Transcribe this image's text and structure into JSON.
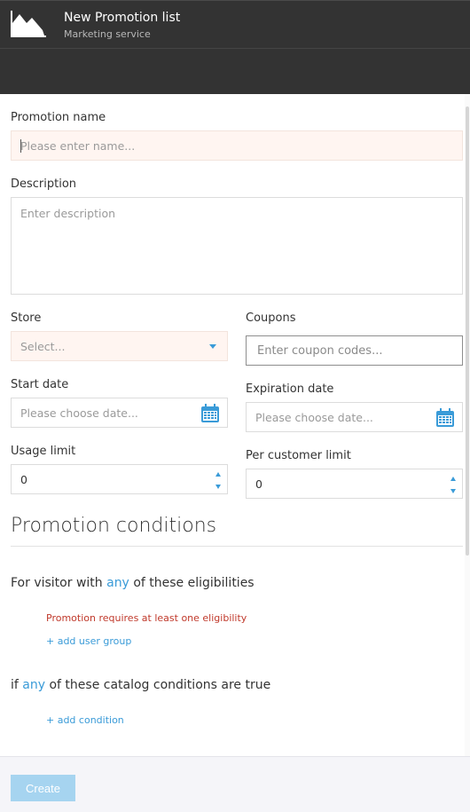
{
  "header": {
    "title": "New Promotion list",
    "subtitle": "Marketing service",
    "logo_icon": "area-chart-icon"
  },
  "form": {
    "promotion_name": {
      "label": "Promotion name",
      "placeholder": "Please enter name...",
      "value": ""
    },
    "description": {
      "label": "Description",
      "placeholder": "Enter description",
      "value": ""
    },
    "store": {
      "label": "Store",
      "placeholder": "Select...",
      "icon": "chevron-down-icon"
    },
    "coupons": {
      "label": "Coupons",
      "placeholder": "Enter coupon codes..."
    },
    "start_date": {
      "label": "Start date",
      "placeholder": "Please choose date...",
      "icon": "calendar-icon"
    },
    "expiration_date": {
      "label": "Expiration date",
      "placeholder": "Please choose date...",
      "icon": "calendar-icon"
    },
    "usage_limit": {
      "label": "Usage limit",
      "value": "0"
    },
    "per_customer_limit": {
      "label": "Per customer limit",
      "value": "0"
    }
  },
  "conditions": {
    "title": "Promotion conditions",
    "visitor": {
      "prefix": "For visitor with",
      "any_link": "any",
      "suffix": "of these eligibilities",
      "error": "Promotion requires at least one eligibility",
      "add_link": "+ add user group"
    },
    "catalog": {
      "prefix": "if",
      "any_link": "any",
      "suffix": "of these catalog conditions are true",
      "add_link": "+ add condition"
    }
  },
  "footer": {
    "create_label": "Create"
  },
  "colors": {
    "header_bg": "#333333",
    "accent": "#3a9bd8",
    "error": "#c0392b",
    "invalid_bg": "#fff5f1",
    "create_btn": "#a6d4f0"
  }
}
